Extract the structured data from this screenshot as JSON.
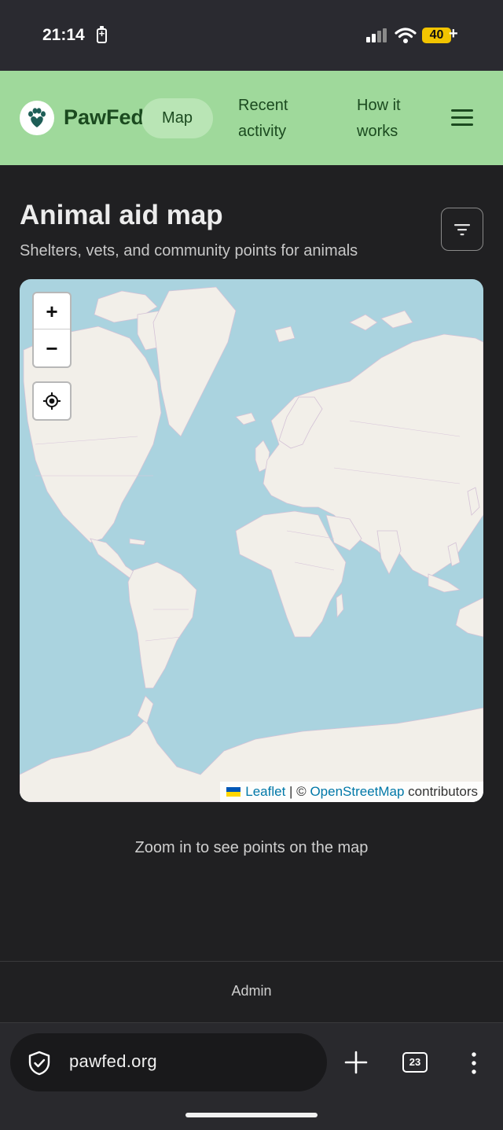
{
  "status_bar": {
    "time": "21:14",
    "battery": "40"
  },
  "nav": {
    "brand": "PawFed",
    "items": [
      {
        "label": "Map",
        "active": true
      },
      {
        "label": "Recent activity",
        "active": false
      },
      {
        "label": "How it works",
        "active": false
      }
    ],
    "menu_icon": "hamburger-icon",
    "logo_icon": "paw-heart-icon",
    "accent_color": "#9fd99b"
  },
  "page": {
    "title": "Animal aid map",
    "subtitle": "Shelters, vets, and community points for animals",
    "filter_icon": "filter-icon"
  },
  "map": {
    "zoom_in": "+",
    "zoom_out": "−",
    "locate_icon": "locate-icon",
    "attribution": {
      "leaflet": "Leaflet",
      "separator": " | © ",
      "osm": "OpenStreetMap",
      "suffix": " contributors"
    }
  },
  "hint": "Zoom in to see points on the map",
  "footer": {
    "admin": "Admin"
  },
  "browser": {
    "url": "pawfed.org",
    "tab_count": "23"
  }
}
